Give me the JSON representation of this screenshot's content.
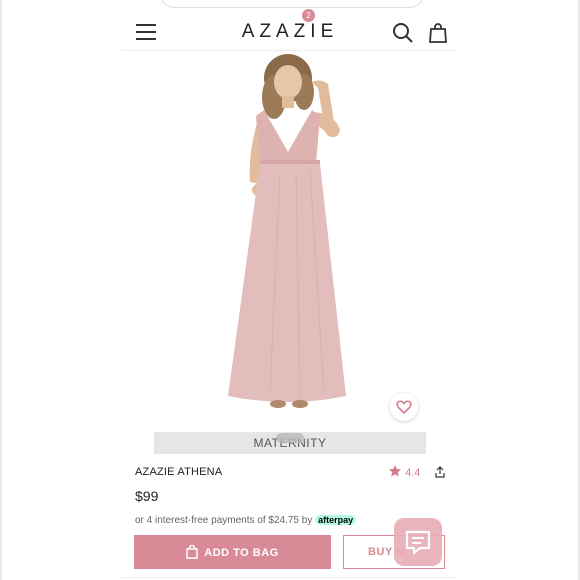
{
  "header": {
    "logo": "AZAZIE",
    "cart_count": "2",
    "icons": {
      "menu": "hamburger-menu-icon",
      "search": "search-icon",
      "bag": "shopping-bag-icon"
    }
  },
  "product": {
    "category": "MATERNITY",
    "name": "AZAZIE ATHENA",
    "rating": "4.4",
    "price": "$99",
    "installment_text": "or 4 interest-free payments of $24.75 by",
    "afterpay_label": "afterpay"
  },
  "actions": {
    "add_to_bag": "ADD TO BAG",
    "buy_now": "BUY N"
  },
  "colors": {
    "accent": "#d98a97",
    "dress": "#e3bcbc",
    "rating": "#d47b8c"
  }
}
